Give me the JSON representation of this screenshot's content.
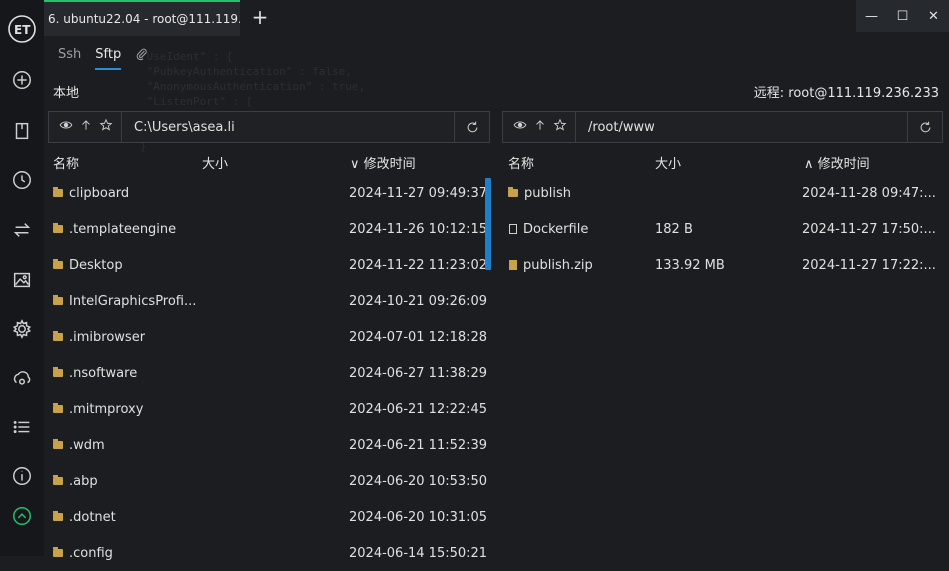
{
  "tab": {
    "title": "6. ubuntu22.04 - root@111.119.2...",
    "new_tab": "+"
  },
  "window": {
    "minimize": "—",
    "maximize": "☐",
    "close": "✕"
  },
  "subtabs": {
    "ssh": "Ssh",
    "sftp": "Sftp",
    "attach_icon": "paperclip-icon"
  },
  "local_label": "本地",
  "remote_label": "远程: root@111.119.236.233",
  "local": {
    "path": "C:\\Users\\asea.li",
    "columns": {
      "name": "名称",
      "size": "大小",
      "modified_sort": "∨",
      "modified": "修改时间"
    },
    "files": [
      {
        "name": "clipboard",
        "type": "folder",
        "modified": "2024-11-27 09:49:37"
      },
      {
        "name": ".templateengine",
        "type": "folder",
        "modified": "2024-11-26 10:12:15"
      },
      {
        "name": "Desktop",
        "type": "folder",
        "modified": "2024-11-22 11:23:02"
      },
      {
        "name": "IntelGraphicsProfi...",
        "type": "folder",
        "modified": "2024-10-21 09:26:09"
      },
      {
        "name": ".imibrowser",
        "type": "folder",
        "modified": "2024-07-01 12:18:28"
      },
      {
        "name": ".nsoftware",
        "type": "folder",
        "modified": "2024-06-27 11:38:29"
      },
      {
        "name": ".mitmproxy",
        "type": "folder",
        "modified": "2024-06-21 12:22:45"
      },
      {
        "name": ".wdm",
        "type": "folder",
        "modified": "2024-06-21 11:52:39"
      },
      {
        "name": ".abp",
        "type": "folder",
        "modified": "2024-06-20 10:53:50"
      },
      {
        "name": ".dotnet",
        "type": "folder",
        "modified": "2024-06-20 10:31:05"
      },
      {
        "name": ".config",
        "type": "folder",
        "modified": "2024-06-14 15:50:21"
      }
    ]
  },
  "remote": {
    "path": "/root/www",
    "columns": {
      "name": "名称",
      "size": "大小",
      "modified_sort": "∧",
      "modified": "修改时间"
    },
    "files": [
      {
        "name": "publish",
        "type": "folder",
        "size": "",
        "modified": "2024-11-28 09:47:..."
      },
      {
        "name": "Dockerfile",
        "type": "doc",
        "size": "182 B",
        "modified": "2024-11-27 17:50:..."
      },
      {
        "name": "publish.zip",
        "type": "zip",
        "size": "133.92 MB",
        "modified": "2024-11-27 17:22:..."
      }
    ]
  },
  "accent": "#2a8bd6",
  "tab_indicator": "#24c36b"
}
